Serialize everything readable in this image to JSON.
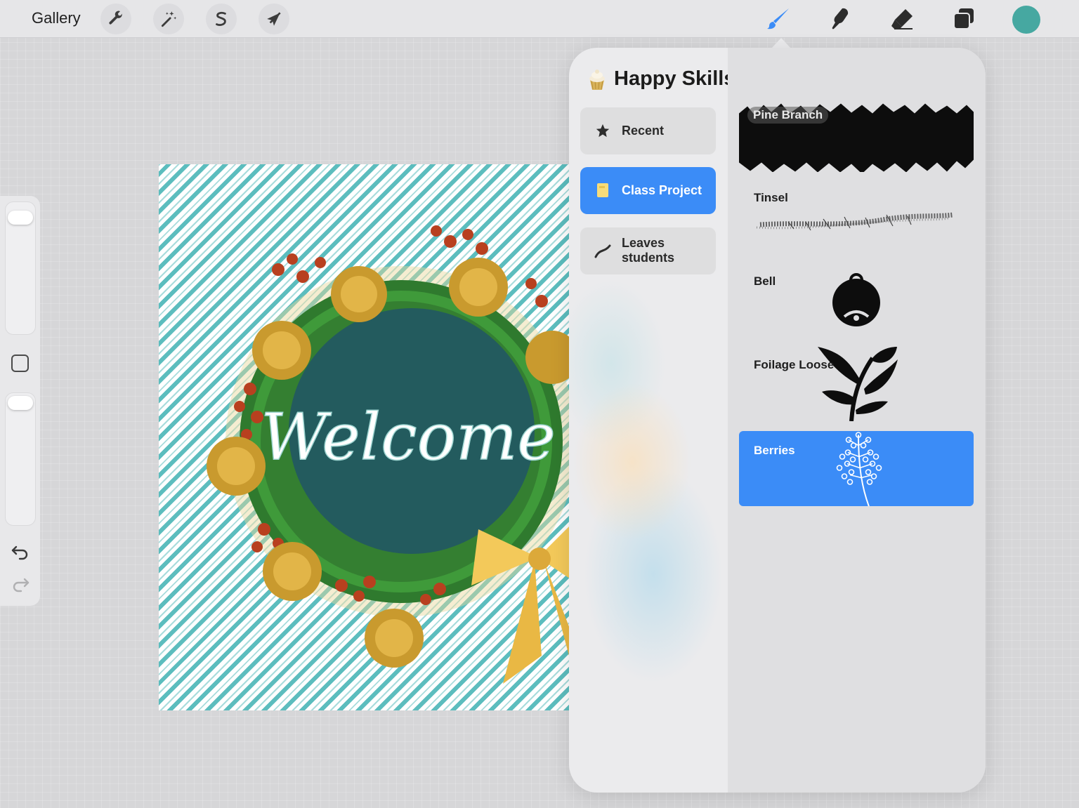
{
  "topbar": {
    "gallery_label": "Gallery",
    "actions_icon": "wrench-icon",
    "adjustments_icon": "magic-wand-icon",
    "selection_icon": "selection-s-icon",
    "transform_icon": "arrow-cursor-icon",
    "brush_icon": "brush-icon",
    "smudge_icon": "smudge-icon",
    "eraser_icon": "eraser-icon",
    "layers_icon": "layers-icon",
    "current_color": "#46a8a1",
    "active_tool_color": "#3b8cf7"
  },
  "canvas": {
    "artwork_text": "Welcome"
  },
  "brush_library": {
    "title": "Happy Skills",
    "title_icon": "cupcake-icon",
    "add_icon": "plus-icon",
    "sets": [
      {
        "label": "Recent",
        "icon": "star-icon",
        "active": false
      },
      {
        "label": "Class Project",
        "icon": "notebook-icon",
        "active": true
      },
      {
        "label": "Leaves\nstudents",
        "icon": "stroke-icon",
        "active": false
      }
    ],
    "brushes": [
      {
        "name": "Pine Branch",
        "selected": false
      },
      {
        "name": "Tinsel",
        "selected": false
      },
      {
        "name": "Bell",
        "selected": false
      },
      {
        "name": "Foilage Loose",
        "selected": false
      },
      {
        "name": "Berries",
        "selected": true
      }
    ]
  }
}
